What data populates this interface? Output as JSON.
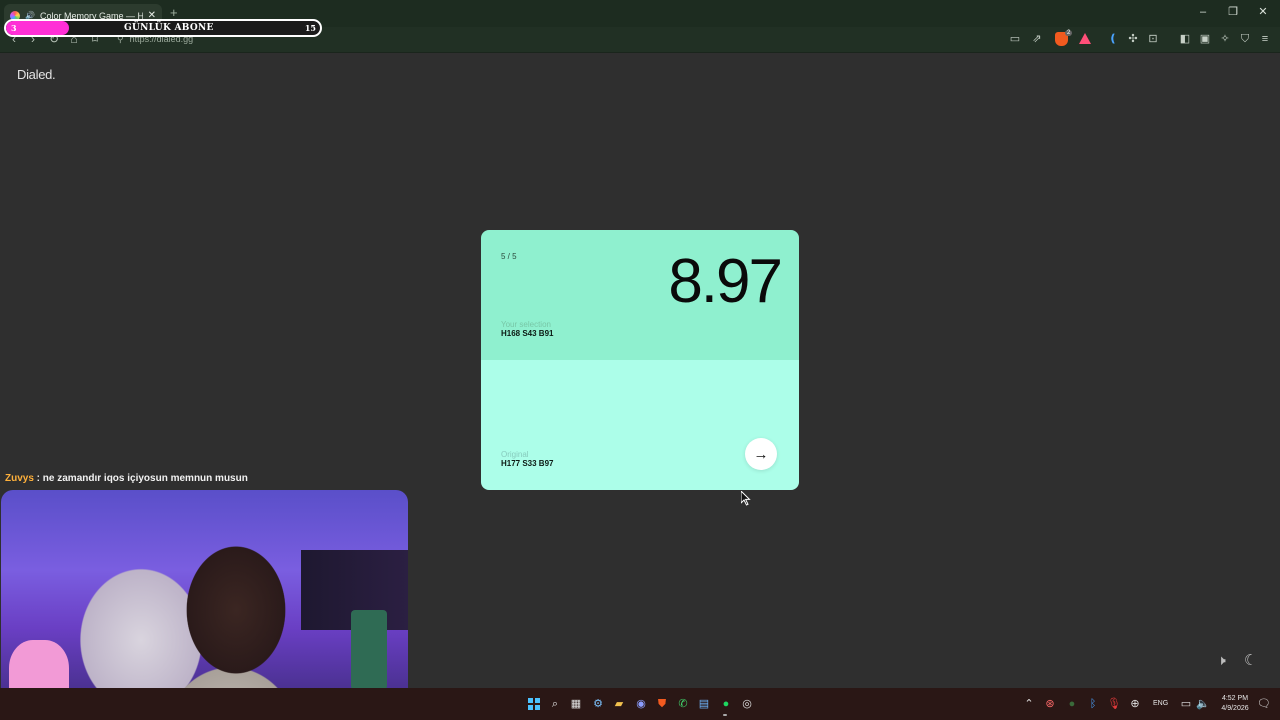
{
  "browser": {
    "tab_title": "Color Memory Game — How good are you at remembering colors?",
    "new_tab": "+",
    "url": "https://dialed.gg"
  },
  "overlay": {
    "sub_count": "3",
    "sub_label": "GÜNLÜK ABONE",
    "sub_goal": "15",
    "sub_progress": 0.2,
    "chat_user": "Zuvys",
    "chat_message": " : ne zamandır iqos içiyosun memnun musun"
  },
  "page": {
    "logo": "Dialed.",
    "round": "5 / 5",
    "score": "8.97",
    "selection_label": "Your selection",
    "selection_value": "H168 S43 B91",
    "original_label": "Original",
    "original_value": "H177 S33 B97",
    "selection_color": "#8ff0cf",
    "original_color": "#acfee9"
  },
  "taskbar": {
    "language": "ENG",
    "time": "4:52 PM",
    "date": "4/9/2026"
  },
  "icons": {
    "back": "arrow-left",
    "forward": "arrow-right",
    "reload": "reload",
    "home": "home",
    "bookmark": "bookmark",
    "next": "arrow-right",
    "sound": "speaker",
    "theme": "moon"
  }
}
